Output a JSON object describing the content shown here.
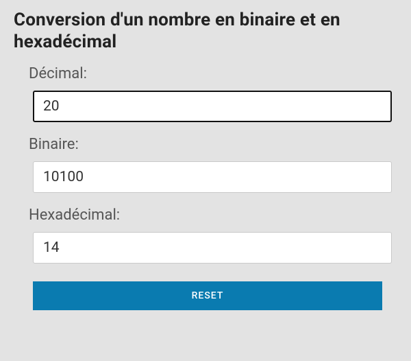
{
  "title": "Conversion d'un nombre en binaire et en hexadécimal",
  "fields": {
    "decimal": {
      "label": "Décimal:",
      "value": "20"
    },
    "binary": {
      "label": "Binaire:",
      "value": "10100"
    },
    "hex": {
      "label": "Hexadécimal:",
      "value": "14"
    }
  },
  "reset_label": "RESET"
}
